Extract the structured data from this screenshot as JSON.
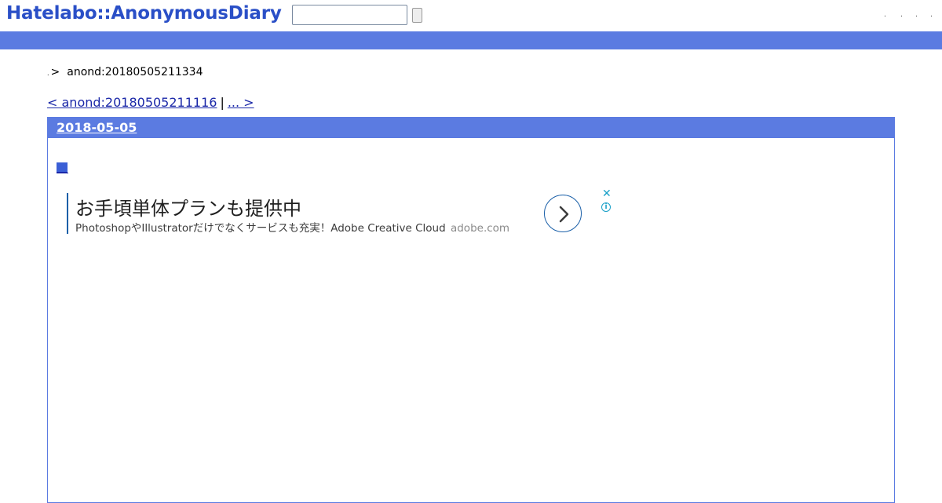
{
  "header": {
    "logo_text": "Hatelabo::AnonymousDiary",
    "search": {
      "value": "",
      "placeholder": ""
    },
    "search_button_label": "",
    "menu_dots": [
      ".",
      ".",
      ".",
      "."
    ]
  },
  "breadcrumb": {
    "home_dot": ".",
    "separator": ">",
    "current": "anond:20180505211334"
  },
  "pager": {
    "prev_label": "< anond:20180505211116",
    "divider": "|",
    "next_label": "... > "
  },
  "day": {
    "date": "2018-05-05"
  },
  "ad": {
    "title": "お手頃単体プランも提供中",
    "description": "PhotoshopやIllustratorだけでなくサービスも充実！Adobe Creative Cloud",
    "domain": "adobe.com",
    "close_glyph": "✕",
    "info_glyph": "i"
  },
  "colors": {
    "brand_blue": "#5b7be1",
    "logo_blue": "#2a4fc7",
    "link_blue": "#1a27a8",
    "ad_accent": "#18a0c8"
  }
}
